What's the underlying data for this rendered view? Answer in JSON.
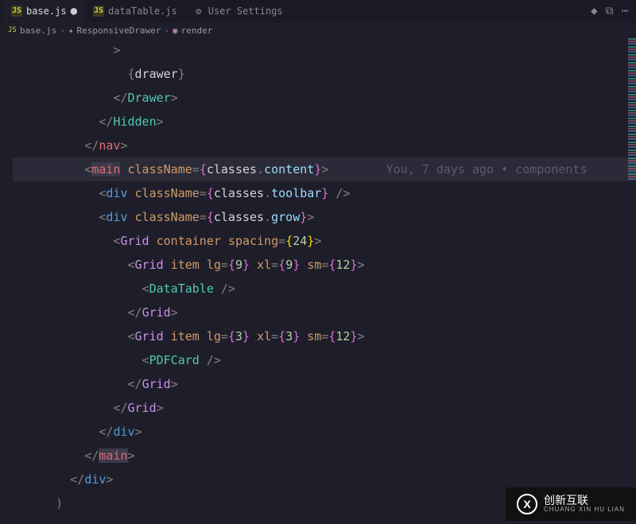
{
  "tabs": [
    {
      "icon": "JS",
      "label": "base.js",
      "modified": true,
      "active": true
    },
    {
      "icon": "JS",
      "label": "dataTable.js",
      "modified": false,
      "active": false
    },
    {
      "icon": "gear",
      "label": "User Settings",
      "modified": false,
      "active": false
    }
  ],
  "breadcrumb": {
    "items": [
      "base.js",
      "ResponsiveDrawer",
      "render"
    ]
  },
  "blame": "You, 7 days ago • components",
  "code": {
    "l1": "              >",
    "l2a": "                {",
    "l2b": "drawer",
    "l2c": "}",
    "l3a": "              </",
    "l3b": "Drawer",
    "l3c": ">",
    "l4a": "            </",
    "l4b": "Hidden",
    "l4c": ">",
    "l5a": "          </",
    "l5b": "nav",
    "l5c": ">",
    "l6a": "          <",
    "l6b": "main",
    "l6c": " ",
    "l6d": "className",
    "l6e": "=",
    "l6f": "{",
    "l6g": "classes",
    "l6h": ".",
    "l6i": "content",
    "l6j": "}",
    "l6k": ">",
    "l7a": "            <",
    "l7b": "div",
    "l7c": " ",
    "l7d": "className",
    "l7e": "=",
    "l7f": "{",
    "l7g": "classes",
    "l7h": ".",
    "l7i": "toolbar",
    "l7j": "}",
    "l7k": " />",
    "l8a": "            <",
    "l8b": "div",
    "l8c": " ",
    "l8d": "className",
    "l8e": "=",
    "l8f": "{",
    "l8g": "classes",
    "l8h": ".",
    "l8i": "grow",
    "l8j": "}",
    "l8k": ">",
    "l9a": "              <",
    "l9b": "Grid",
    "l9c": " ",
    "l9d": "container",
    "l9e": " ",
    "l9f": "spacing",
    "l9g": "=",
    "l9h": "{",
    "l9i": "24",
    "l9j": "}",
    "l9k": ">",
    "l10a": "                <",
    "l10b": "Grid",
    "l10c": " ",
    "l10d": "item",
    "l10e": " ",
    "l10f": "lg",
    "l10g": "=",
    "l10h": "{",
    "l10i": "9",
    "l10j": "}",
    "l10k": " ",
    "l10l": "xl",
    "l10m": "=",
    "l10n": "{",
    "l10o": "9",
    "l10p": "}",
    "l10q": " ",
    "l10r": "sm",
    "l10s": "=",
    "l10t": "{",
    "l10u": "12",
    "l10v": "}",
    "l10w": ">",
    "l11a": "                  <",
    "l11b": "DataTable",
    "l11c": " />",
    "l12a": "                </",
    "l12b": "Grid",
    "l12c": ">",
    "l13a": "                <",
    "l13b": "Grid",
    "l13c": " ",
    "l13d": "item",
    "l13e": " ",
    "l13f": "lg",
    "l13g": "=",
    "l13h": "{",
    "l13i": "3",
    "l13j": "}",
    "l13k": " ",
    "l13l": "xl",
    "l13m": "=",
    "l13n": "{",
    "l13o": "3",
    "l13p": "}",
    "l13q": " ",
    "l13r": "sm",
    "l13s": "=",
    "l13t": "{",
    "l13u": "12",
    "l13v": "}",
    "l13w": ">",
    "l14a": "                  <",
    "l14b": "PDFCard",
    "l14c": " />",
    "l15a": "                </",
    "l15b": "Grid",
    "l15c": ">",
    "l16a": "              </",
    "l16b": "Grid",
    "l16c": ">",
    "l17a": "            </",
    "l17b": "div",
    "l17c": ">",
    "l18a": "          </",
    "l18b": "main",
    "l18c": ">",
    "l19a": "        </",
    "l19b": "div",
    "l19c": ">",
    "l20": "      )"
  },
  "watermark": {
    "logo": "X",
    "text": "创新互联",
    "sub": "CHUANG XIN HU LIAN"
  }
}
